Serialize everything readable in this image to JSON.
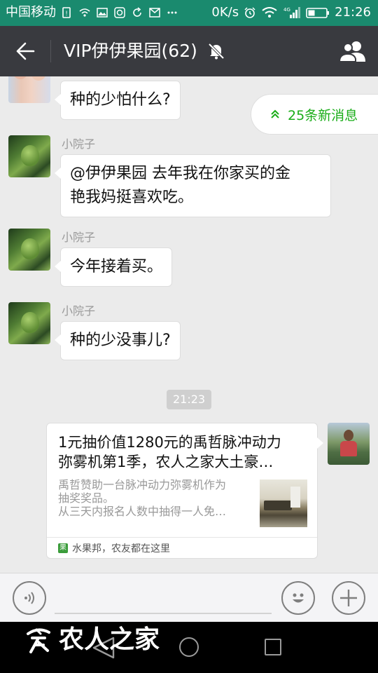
{
  "status_bar": {
    "carrier": "中国移动",
    "speed": "0K/s",
    "network": "4G",
    "time": "21:26",
    "icons": [
      "sim-alert-icon",
      "wifi-call-icon",
      "image-icon",
      "app-icon",
      "sync-icon",
      "message-icon",
      "more-icon",
      "alarm-icon",
      "wifi-icon",
      "signal-icon",
      "battery-icon"
    ]
  },
  "header": {
    "title": "VIP伊伊果园(62)",
    "muted": true
  },
  "new_messages": {
    "label": "25条新消息",
    "accent": "#1aad19"
  },
  "messages": [
    {
      "sender": "",
      "text": "种的少怕什么?",
      "avatar": "kids-avatar"
    },
    {
      "sender": "小院子",
      "text_lines": [
        "@伊伊果园 去年我在你家买的金",
        "艳我妈挺喜欢吃。"
      ],
      "avatar": "leaf-avatar"
    },
    {
      "sender": "小院子",
      "text": "今年接着买。",
      "avatar": "leaf-avatar"
    },
    {
      "sender": "小院子",
      "text": "种的少没事儿?",
      "avatar": "leaf-avatar"
    }
  ],
  "timestamp": "21:23",
  "shared_card": {
    "title_lines": [
      "1元抽价值1280元的禹哲脉冲动力",
      "弥雾机第1季，农人之家大土豪…"
    ],
    "desc_lines": [
      "禹哲赞助一台脉冲动力弥雾机作为",
      "抽奖奖品。",
      "从三天内报名人数中抽得一人免…"
    ],
    "source_icon": "果",
    "source": "水果邦，农友都在这里"
  },
  "input": {
    "placeholder": ""
  },
  "watermark": {
    "text": "农人之家"
  },
  "colors": {
    "status_bar": "#1a8a6e",
    "title_bar": "#393a3f",
    "chat_bg": "#ebebeb",
    "accent_green": "#1aad19"
  }
}
